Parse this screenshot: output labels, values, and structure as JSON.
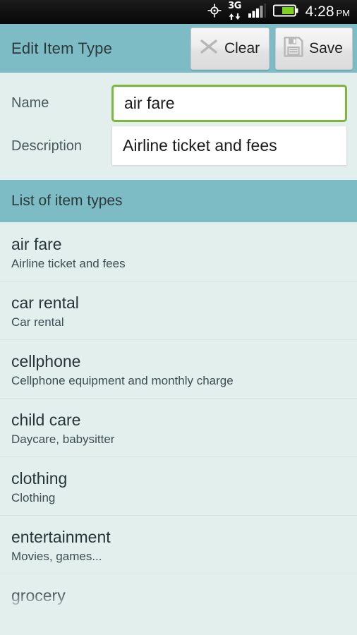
{
  "statusbar": {
    "icons": [
      "gps-icon",
      "3g-network-icon",
      "signal-icon",
      "battery-icon"
    ],
    "network_label": "3G",
    "time": "4:28",
    "ampm": "PM",
    "background_color": "#121212"
  },
  "actionbar": {
    "title": "Edit Item Type",
    "background_color": "#7ebcc5",
    "buttons": [
      {
        "label": "Clear",
        "icon": "clear-x-icon"
      },
      {
        "label": "Save",
        "icon": "floppy-disk-save-icon"
      }
    ]
  },
  "form": {
    "name": {
      "label": "Name",
      "value": "air fare",
      "placeholder": "",
      "focused": true,
      "focus_color": "#7fb53f"
    },
    "description": {
      "label": "Description",
      "value": "Airline ticket and fees",
      "placeholder": "",
      "focused": false
    }
  },
  "section": {
    "title": "List of item types",
    "background_color": "#7ebcc5"
  },
  "list": {
    "items": [
      {
        "title": "air fare",
        "desc": "Airline ticket and fees"
      },
      {
        "title": "car rental",
        "desc": "Car rental"
      },
      {
        "title": "cellphone",
        "desc": "Cellphone equipment and monthly charge"
      },
      {
        "title": "child care",
        "desc": "Daycare, babysitter"
      },
      {
        "title": "clothing",
        "desc": "Clothing"
      },
      {
        "title": "entertainment",
        "desc": "Movies, games..."
      },
      {
        "title": "grocery",
        "desc": ""
      }
    ]
  }
}
